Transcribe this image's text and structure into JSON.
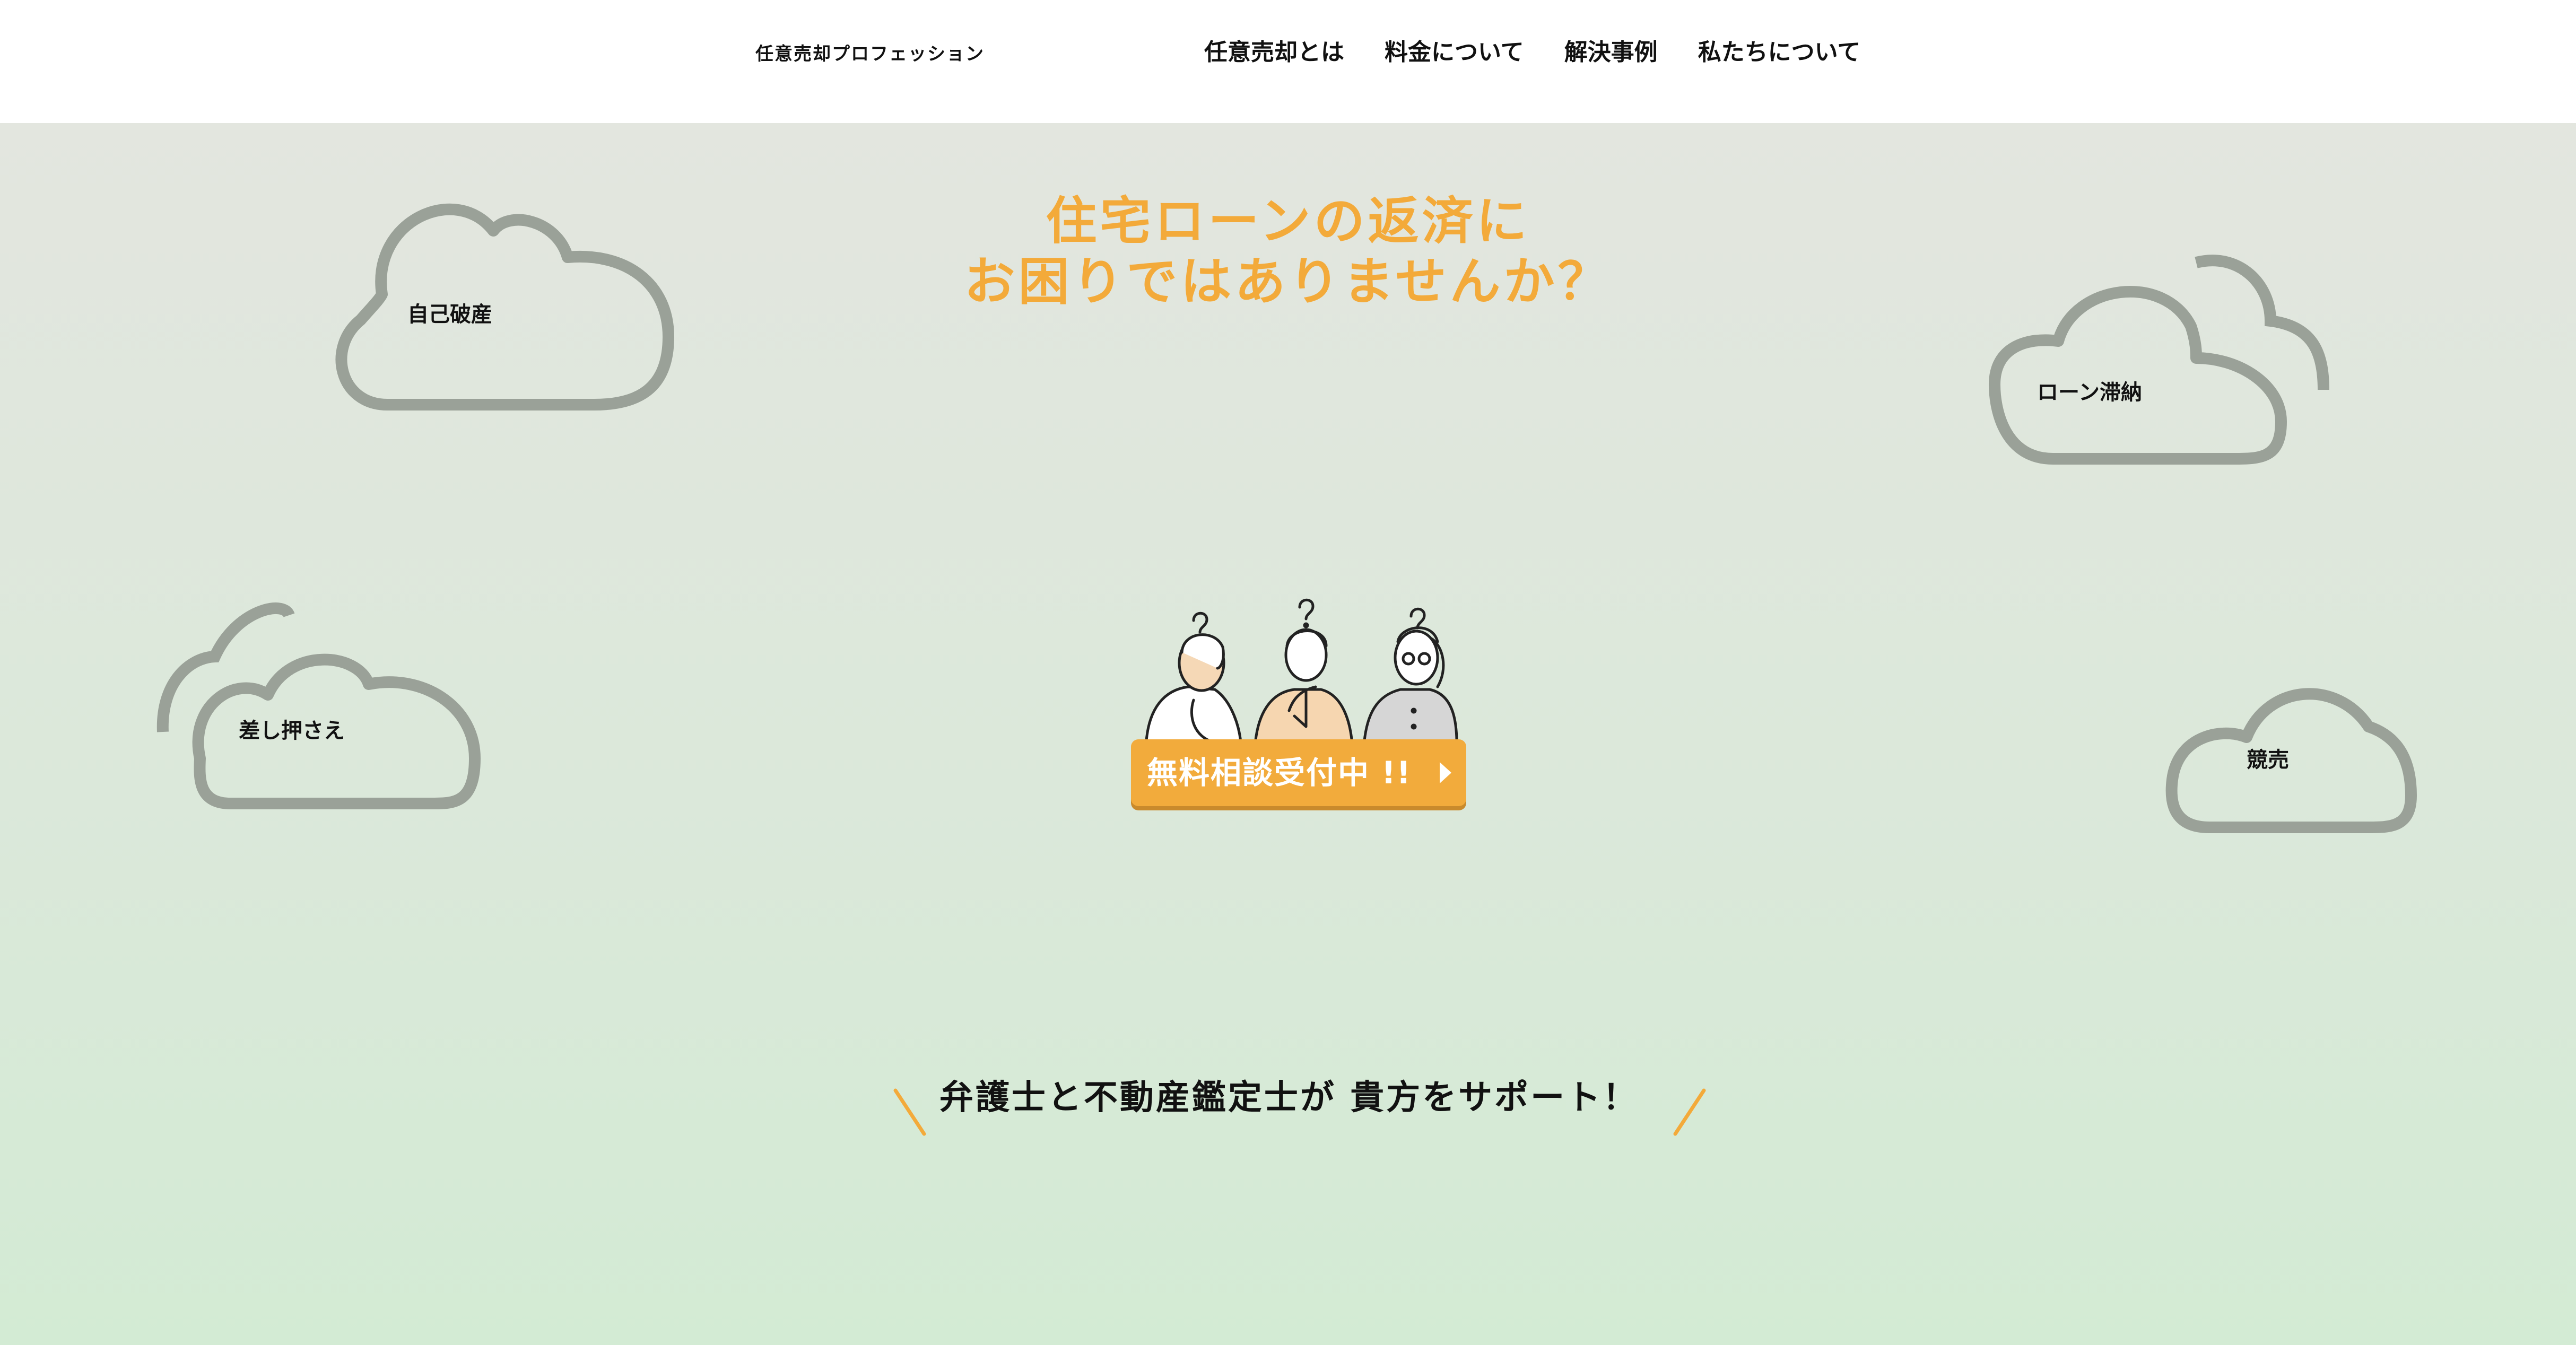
{
  "header": {
    "logo": "任意売却プロフェッション",
    "nav": [
      "任意売却とは",
      "料金について",
      "解決事例",
      "私たちについて"
    ]
  },
  "hero": {
    "headline_line1": "住宅ローンの返済に",
    "headline_line2": "お困りではありませんか？",
    "clouds": [
      "自己破産",
      "ローン滞納",
      "差し押さえ",
      "競売"
    ],
    "cta_label": "無料相談受付中 !!",
    "tagline": "弁護士と不動産鑑定士が 貴方をサポート！"
  },
  "icons": {
    "cta_arrow": "play-triangle-icon",
    "illustration": "three-people-wondering-illustration",
    "cloud": "cloud-outline-icon"
  },
  "colors": {
    "accent": "#f3aa3a",
    "button": "#f2ab3c",
    "cloud_stroke": "#9aa198",
    "bg_top": "#e3e6df",
    "bg_bottom": "#d3ebd4"
  }
}
